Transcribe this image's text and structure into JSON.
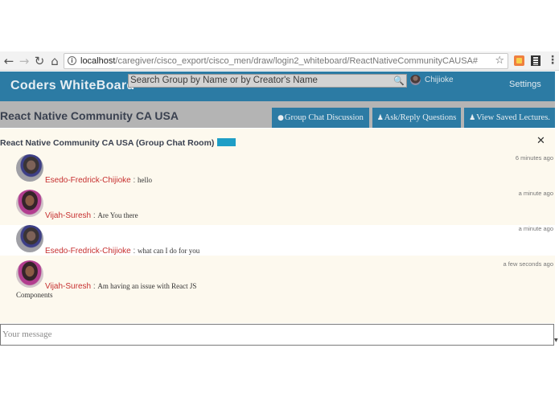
{
  "browser": {
    "url_host": "localhost",
    "url_path": "/caregiver/cisco_export/cisco_men/draw/login2_whiteboard/ReactNativeCommunityCAUSA#",
    "back_icon": "back-arrow-icon",
    "forward_icon": "forward-arrow-icon"
  },
  "header": {
    "app_title": "Coders WhiteBoard",
    "search_placeholder": "Search Group by Name or by Creator's Name",
    "user_name": "Chijioke",
    "settings_label": "Settings"
  },
  "subheader": {
    "group_title": "React Native Community CA USA",
    "tabs": [
      {
        "icon": "globe-icon",
        "label": "Group Chat Discussion"
      },
      {
        "icon": "user-icon",
        "label": "Ask/Reply Questions"
      },
      {
        "icon": "user-icon",
        "label": "View Saved Lectures."
      }
    ]
  },
  "chat": {
    "heading": "React Native Community CA USA (Group Chat Room)",
    "accent_color": "#1e9ec6",
    "messages": [
      {
        "time": "6 minutes ago",
        "sender": "Esedo-Fredrick-Chijioke",
        "text": "hello"
      },
      {
        "time": "a minute ago",
        "sender": "Vijah-Suresh",
        "text": "Are You there"
      },
      {
        "time": "a minute ago",
        "sender": "Esedo-Fredrick-Chijioke",
        "text": "what can I do for you"
      },
      {
        "time": "a few seconds ago",
        "sender": "Vijah-Suresh",
        "text": "Am having an issue with React JS",
        "text_cont": "Components"
      }
    ],
    "separator": " : ",
    "input_placeholder": "Your message"
  },
  "colors": {
    "header_bg": "#2c7ba4",
    "subheader_bg": "#b4b4b4",
    "sender_color": "#c62f2f",
    "chat_bg": "#fdf9ee"
  }
}
